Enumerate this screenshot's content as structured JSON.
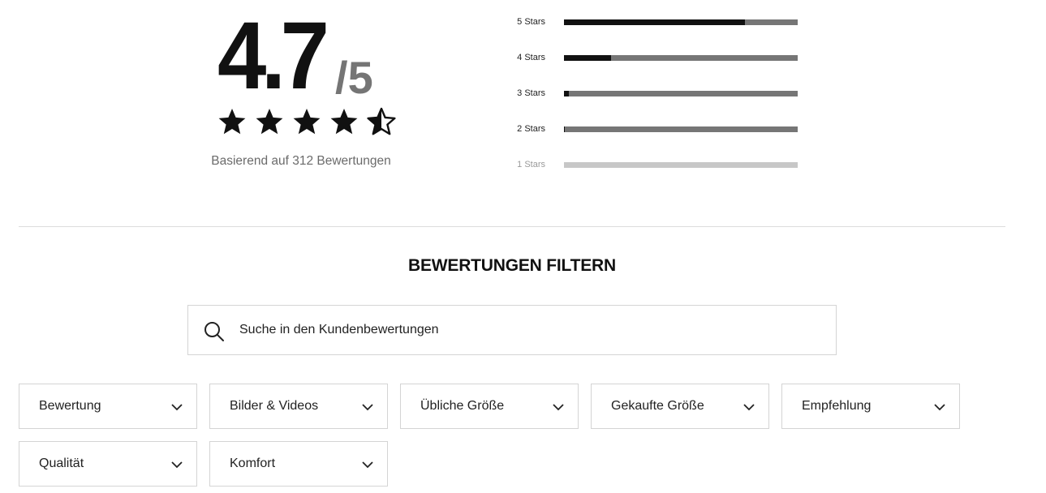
{
  "rating": {
    "value": "4.7",
    "max": "/5",
    "stars": 4.7,
    "based_on": "Basierend auf 312 Bewertungen"
  },
  "distribution": [
    {
      "label": "5 Stars",
      "fraction": 0.775,
      "muted": false
    },
    {
      "label": "4 Stars",
      "fraction": 0.2,
      "muted": false
    },
    {
      "label": "3 Stars",
      "fraction": 0.02,
      "muted": false
    },
    {
      "label": "2 Stars",
      "fraction": 0.005,
      "muted": false
    },
    {
      "label": "1 Stars",
      "fraction": 0.0,
      "muted": true
    }
  ],
  "filter": {
    "title": "BEWERTUNGEN FILTERN",
    "search_placeholder": "Suche in den Kundenbewertungen",
    "search_icon": "search-icon",
    "dropdowns": [
      {
        "label": "Bewertung"
      },
      {
        "label": "Bilder & Videos"
      },
      {
        "label": "Übliche Größe"
      },
      {
        "label": "Gekaufte Größe"
      },
      {
        "label": "Empfehlung"
      },
      {
        "label": "Qualität"
      },
      {
        "label": "Komfort"
      }
    ]
  },
  "colors": {
    "text": "#111111",
    "muted_text": "#6b6b6b",
    "bar_filled": "#111111",
    "bar_track": "#767676",
    "bar_track_muted": "#c7c7c7",
    "border": "#d4d4d4"
  }
}
